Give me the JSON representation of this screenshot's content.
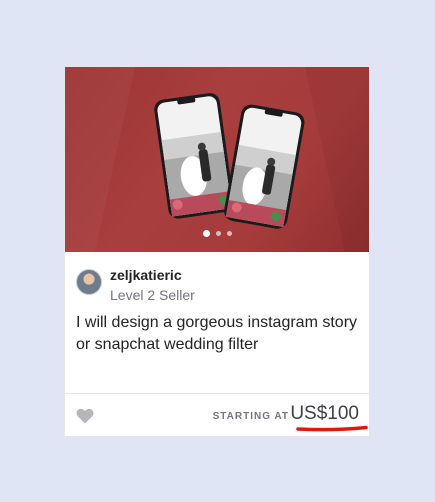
{
  "colors": {
    "page_bg": "#e0e5f6",
    "media_bg": "#a63b3b",
    "accent_underline": "#e0190f",
    "text_dark": "#222325",
    "text_muted": "#74767e"
  },
  "gig": {
    "seller_name": "zeljkatieric",
    "seller_level": "Level 2 Seller",
    "title": "I will design a gorgeous instagram story or snapchat wedding filter",
    "starting_label": "STARTING AT",
    "price": "US$100",
    "carousel": {
      "slides": 3,
      "active_index": 0
    }
  },
  "icons": {
    "favorite": "heart-icon",
    "avatar": "seller-avatar"
  }
}
